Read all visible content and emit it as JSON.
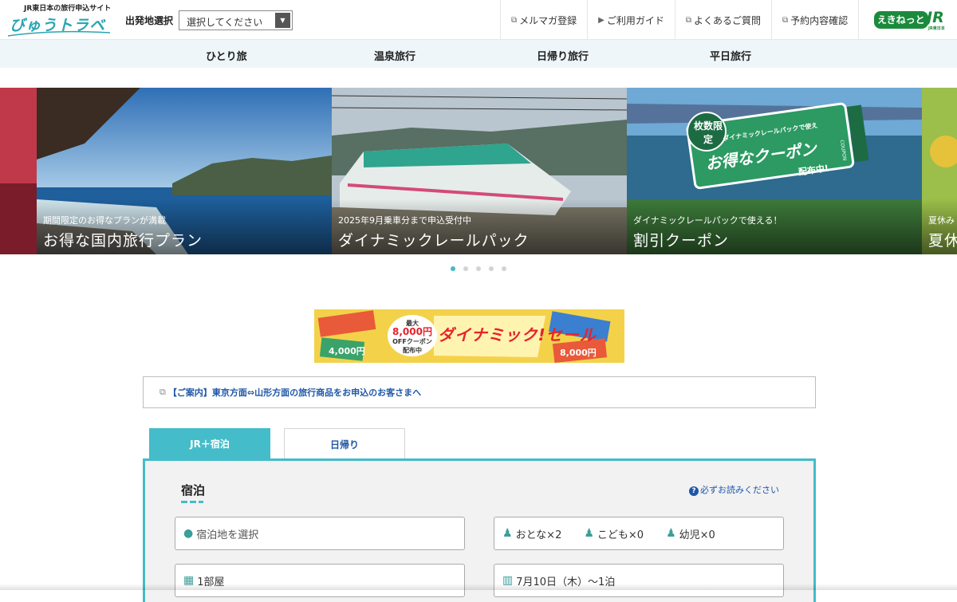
{
  "header": {
    "brand_tagline": "JR東日本の旅行申込サイト",
    "brand_name": "びゅうトラベル",
    "departure_label": "出発地選択",
    "departure_select_value": "選択してください",
    "utility_links": [
      {
        "label": "メルマガ登録",
        "icon": "external-link-icon"
      },
      {
        "label": "ご利用ガイド",
        "icon": "triangle-right-icon"
      },
      {
        "label": "よくあるご質問",
        "icon": "external-link-icon"
      },
      {
        "label": "予約内容確認",
        "icon": "external-link-icon"
      }
    ],
    "ekinet_logo": "えきねっと",
    "jr_logo": "JR",
    "jr_logo_sub": "JR東日本"
  },
  "category_nav": [
    "ひとり旅",
    "温泉旅行",
    "日帰り旅行",
    "平日旅行"
  ],
  "hero": {
    "slides": [
      {
        "subtitle": "期間限定のお得なプランが満載",
        "title": "お得な国内旅行プラン"
      },
      {
        "subtitle": "2025年9月乗車分まで申込受付中",
        "title": "ダイナミックレールパック"
      },
      {
        "subtitle": "ダイナミックレールパックで使える！",
        "title": "割引クーポン",
        "overlay_badge": "枚数限定",
        "overlay_small": "ダイナミックレールパックで使える",
        "overlay_main": "お得なクーポン",
        "overlay_end": "配布中!",
        "overlay_tag": "COUPON"
      },
      {
        "subtitle": "夏休み",
        "title": "夏休"
      }
    ],
    "dot_count": 5,
    "active_dot": 0
  },
  "banner": {
    "headline": "ダイナミック!セール",
    "max_label": "最大",
    "max_value": "8,000円",
    "max_desc": "OFFクーポン",
    "max_end": "配布中",
    "coupon_left": "4,000円",
    "coupon_right": "8,000円"
  },
  "notice": "【ご案内】東京方面⇔山形方面の旅行商品をお申込のお客さまへ",
  "tabs": [
    {
      "label": "JR＋宿泊",
      "active": true
    },
    {
      "label": "日帰り",
      "active": false
    }
  ],
  "search_panel": {
    "title": "宿泊",
    "help_link": "必ずお読みください",
    "destination_placeholder": "宿泊地を選択",
    "adults": "おとな×2",
    "children": "こども×0",
    "infants": "幼児×0",
    "rooms": "1部屋",
    "date": "7月10日（木）〜1泊"
  },
  "colors": {
    "accent": "#44bcc9",
    "link": "#1f57a8",
    "ekinet_green": "#1c8a3c",
    "sale_red": "#e6232a"
  }
}
